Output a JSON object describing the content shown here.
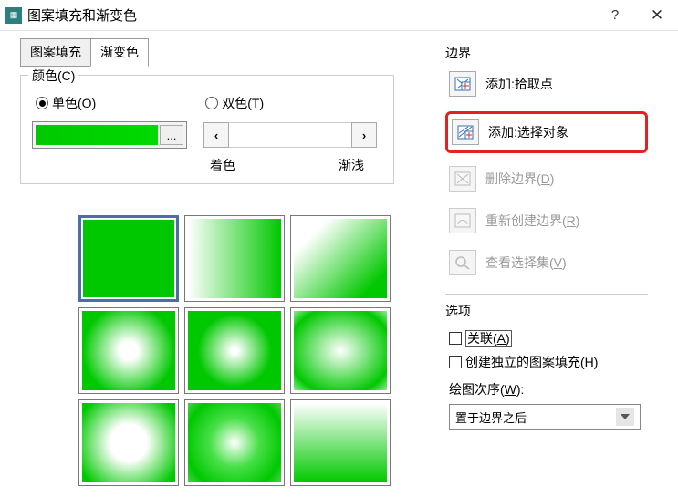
{
  "window": {
    "title": "图案填充和渐变色"
  },
  "tabs": {
    "hatch": "图案填充",
    "gradient": "渐变色"
  },
  "color": {
    "group_label": "颜色(C)",
    "single": "单色",
    "single_key": "O",
    "two": "双色",
    "two_key": "T",
    "browse": "...",
    "slider_left": "‹",
    "slider_right": "›",
    "tint_label": "着色",
    "shade_label": "渐浅",
    "swatch_value": "#00c800"
  },
  "boundary": {
    "title": "边界",
    "add_pick": "添加:拾取点",
    "add_select": "添加:选择对象",
    "remove": "删除边界",
    "remove_key": "D",
    "recreate": "重新创建边界",
    "recreate_key": "R",
    "view": "查看选择集",
    "view_key": "V"
  },
  "options": {
    "title": "选项",
    "associative": "关联",
    "associative_key": "A",
    "separate": "创建独立的图案填充",
    "separate_key": "H",
    "draw_order_label": "绘图次序",
    "draw_order_key": "W",
    "draw_order_value": "置于边界之后"
  }
}
